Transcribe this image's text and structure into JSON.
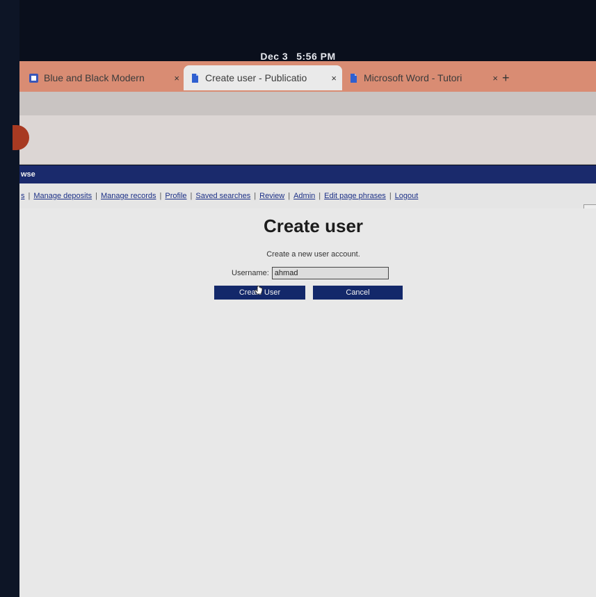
{
  "status": {
    "date": "Dec 3",
    "time": "5:56 PM"
  },
  "browser": {
    "tabs": [
      {
        "title": "Blue and Black Modern",
        "icon": "doc-icon",
        "close": "×"
      },
      {
        "title": "Create user - Publicatio",
        "icon": "doc-icon",
        "close": "×",
        "active": true
      },
      {
        "title": "Microsoft Word - Tutori",
        "icon": "doc-icon",
        "close": "×"
      }
    ],
    "new_tab": "+"
  },
  "site": {
    "header_text": "wse",
    "nav": [
      "s",
      "Manage deposits",
      "Manage records",
      "Profile",
      "Saved searches",
      "Review",
      "Admin",
      "Edit page phrases",
      "Logout"
    ]
  },
  "form": {
    "title": "Create user",
    "subtitle": "Create a new user account.",
    "username_label": "Username:",
    "username_value": "ahmad",
    "create_label": "Create User",
    "cancel_label": "Cancel"
  },
  "colors": {
    "tabstrip": "#d98c73",
    "site_header": "#1a2a6c",
    "button": "#13286a",
    "link": "#1b2f86"
  }
}
